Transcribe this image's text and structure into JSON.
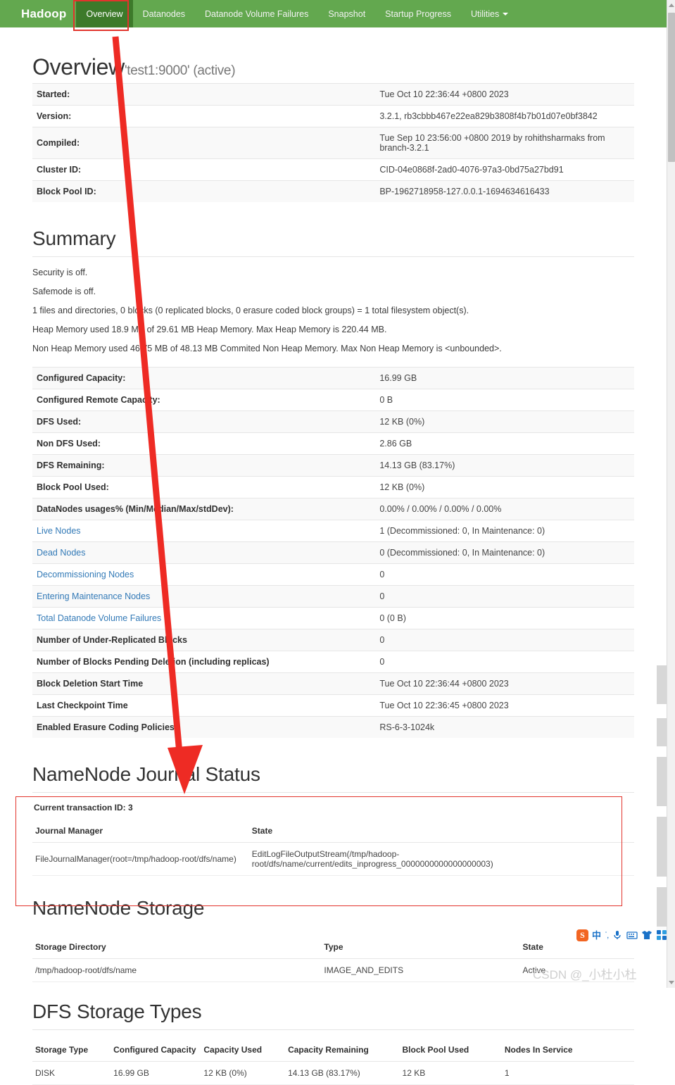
{
  "navbar": {
    "brand": "Hadoop",
    "items": [
      {
        "label": "Overview",
        "active": true
      },
      {
        "label": "Datanodes",
        "active": false
      },
      {
        "label": "Datanode Volume Failures",
        "active": false
      },
      {
        "label": "Snapshot",
        "active": false
      },
      {
        "label": "Startup Progress",
        "active": false
      },
      {
        "label": "Utilities",
        "active": false,
        "has_caret": true
      }
    ]
  },
  "overview": {
    "title": "Overview",
    "subtitle": "'test1:9000' (active)",
    "rows": [
      {
        "key": "Started:",
        "value": "Tue Oct 10 22:36:44 +0800 2023"
      },
      {
        "key": "Version:",
        "value": "3.2.1, rb3cbbb467e22ea829b3808f4b7b01d07e0bf3842"
      },
      {
        "key": "Compiled:",
        "value": "Tue Sep 10 23:56:00 +0800 2019 by rohithsharmaks from branch-3.2.1"
      },
      {
        "key": "Cluster ID:",
        "value": "CID-04e0868f-2ad0-4076-97a3-0bd75a27bd91"
      },
      {
        "key": "Block Pool ID:",
        "value": "BP-1962718958-127.0.0.1-1694634616433"
      }
    ]
  },
  "summary": {
    "title": "Summary",
    "lines": [
      "Security is off.",
      "Safemode is off.",
      "1 files and directories, 0 blocks (0 replicated blocks, 0 erasure coded block groups) = 1 total filesystem object(s).",
      "Heap Memory used 18.9 MB of 29.61 MB Heap Memory. Max Heap Memory is 220.44 MB.",
      "Non Heap Memory used 46.75 MB of 48.13 MB Commited Non Heap Memory. Max Non Heap Memory is <unbounded>."
    ],
    "rows": [
      {
        "key": "Configured Capacity:",
        "value": "16.99 GB",
        "link": false
      },
      {
        "key": "Configured Remote Capacity:",
        "value": "0 B",
        "link": false
      },
      {
        "key": "DFS Used:",
        "value": "12 KB (0%)",
        "link": false
      },
      {
        "key": "Non DFS Used:",
        "value": "2.86 GB",
        "link": false
      },
      {
        "key": "DFS Remaining:",
        "value": "14.13 GB (83.17%)",
        "link": false
      },
      {
        "key": "Block Pool Used:",
        "value": "12 KB (0%)",
        "link": false
      },
      {
        "key": "DataNodes usages% (Min/Median/Max/stdDev):",
        "value": "0.00% / 0.00% / 0.00% / 0.00%",
        "link": false
      },
      {
        "key": "Live Nodes",
        "value": "1 (Decommissioned: 0, In Maintenance: 0)",
        "link": true
      },
      {
        "key": "Dead Nodes",
        "value": "0 (Decommissioned: 0, In Maintenance: 0)",
        "link": true
      },
      {
        "key": "Decommissioning Nodes",
        "value": "0",
        "link": true
      },
      {
        "key": "Entering Maintenance Nodes",
        "value": "0",
        "link": true
      },
      {
        "key": "Total Datanode Volume Failures",
        "value": "0 (0 B)",
        "link": true
      },
      {
        "key": "Number of Under-Replicated Blocks",
        "value": "0",
        "link": false
      },
      {
        "key": "Number of Blocks Pending Deletion (including replicas)",
        "value": "0",
        "link": false
      },
      {
        "key": "Block Deletion Start Time",
        "value": "Tue Oct 10 22:36:44 +0800 2023",
        "link": false
      },
      {
        "key": "Last Checkpoint Time",
        "value": "Tue Oct 10 22:36:45 +0800 2023",
        "link": false
      },
      {
        "key": "Enabled Erasure Coding Policies",
        "value": "RS-6-3-1024k",
        "link": false
      }
    ]
  },
  "journal": {
    "title": "NameNode Journal Status",
    "transaction_label": "Current transaction ID: 3",
    "headers": [
      "Journal Manager",
      "State"
    ],
    "rows": [
      {
        "manager": "FileJournalManager(root=/tmp/hadoop-root/dfs/name)",
        "state": "EditLogFileOutputStream(/tmp/hadoop-root/dfs/name/current/edits_inprogress_0000000000000000003)"
      }
    ]
  },
  "storage": {
    "title": "NameNode Storage",
    "headers": [
      "Storage Directory",
      "Type",
      "State"
    ],
    "rows": [
      {
        "directory": "/tmp/hadoop-root/dfs/name",
        "type": "IMAGE_AND_EDITS",
        "state": "Active"
      }
    ]
  },
  "dfs_storage_types": {
    "title": "DFS Storage Types",
    "headers": [
      "Storage Type",
      "Configured Capacity",
      "Capacity Used",
      "Capacity Remaining",
      "Block Pool Used",
      "Nodes In Service"
    ],
    "rows": [
      {
        "storage_type": "DISK",
        "configured_capacity": "16.99 GB",
        "capacity_used": "12 KB (0%)",
        "capacity_remaining": "14.13 GB (83.17%)",
        "block_pool_used": "12 KB",
        "nodes_in_service": "1"
      }
    ]
  },
  "ime_toolbar": {
    "logo": "S",
    "mode": "中",
    "punctuation": "ˈ,"
  },
  "watermark": "CSDN @_小杜小杜",
  "annotation_colors": {
    "red": "#e2342c",
    "navbar_green": "#63a84f",
    "active_tab_green": "#3d7a2a",
    "link_blue": "#337ab7"
  }
}
